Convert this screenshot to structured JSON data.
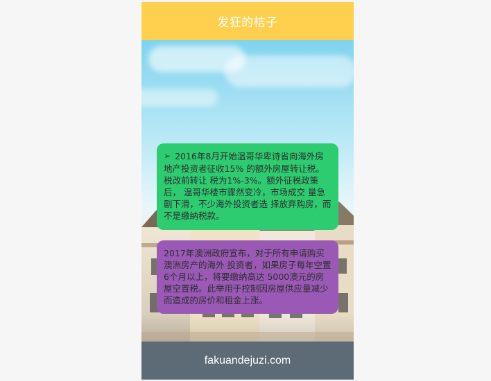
{
  "header": {
    "title": "发狂的桔子",
    "bg": "#ffcf4d"
  },
  "cards": [
    {
      "bullet": "➢",
      "text": "2016年8月开始温哥华卑诗省向海外房地产投资者征收15% 的额外房屋转让税。税改前转让 税为1%-3%。额外征税政策后， 温哥华楼市骤然变冷，市场成交 量急剧下滑，不少海外投资者选 择放弃购房，而不是缴纳税款。",
      "bg": "#2ecc71"
    },
    {
      "text": "2017年澳洲政府宣布，对于所有申请购买澳洲房产的海外 投资者，如果房子每年空置6个月以上，将要缴纳高达 5000澳元的房屋空置税。此举用于控制因房屋供应量减少 而造成的房价和租金上涨。",
      "bg": "#9b59b6"
    }
  ],
  "footer": {
    "text": "fakuandejuzi.com",
    "bg": "#5d6b76"
  },
  "icons": {
    "bullet_icon": "arrow-right-icon"
  }
}
